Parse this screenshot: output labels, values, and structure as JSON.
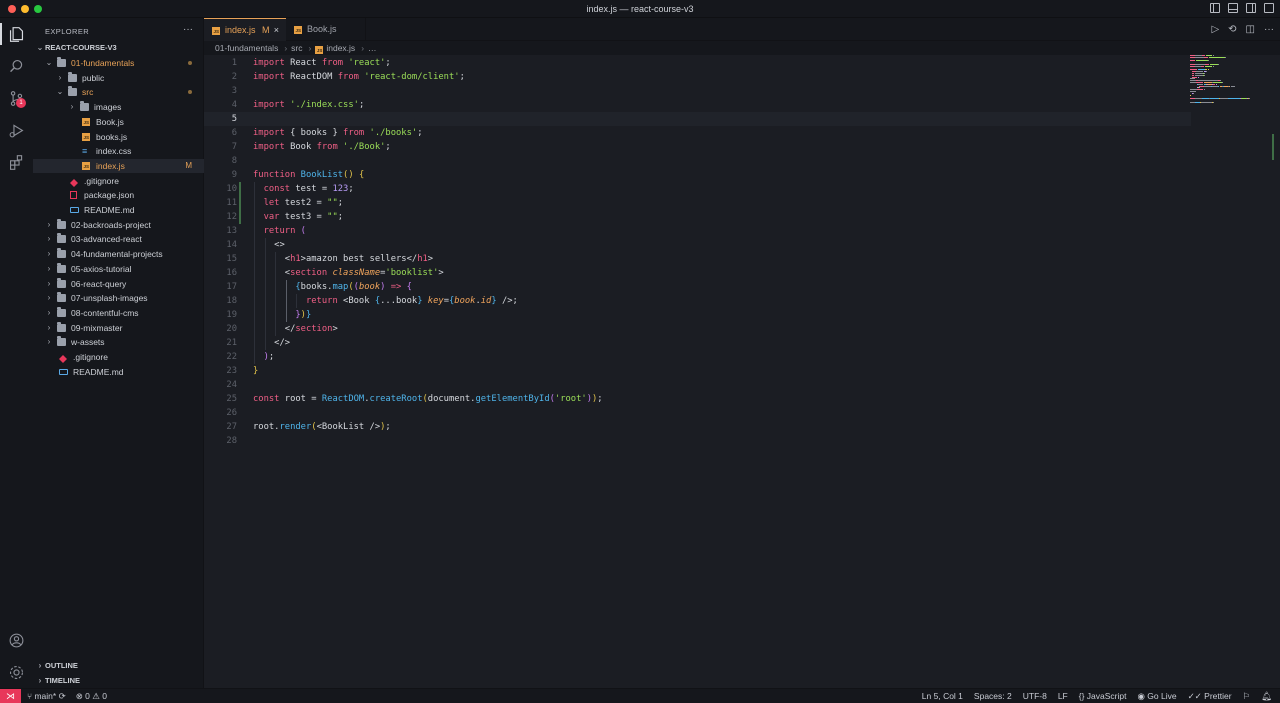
{
  "window": {
    "title": "index.js — react-course-v3"
  },
  "sidebar": {
    "header": "EXPLORER",
    "more": "···",
    "project": "REACT-COURSE-V3",
    "tree": [
      {
        "label": "01-fundamentals",
        "type": "folder",
        "open": true,
        "depth": 1,
        "orange": true,
        "mod": "dot"
      },
      {
        "label": "public",
        "type": "folder",
        "open": false,
        "depth": 2
      },
      {
        "label": "src",
        "type": "folder",
        "open": true,
        "depth": 2,
        "orange": true,
        "mod": "dot"
      },
      {
        "label": "images",
        "type": "folder",
        "open": false,
        "depth": 3
      },
      {
        "label": "Book.js",
        "type": "js",
        "depth": 3
      },
      {
        "label": "books.js",
        "type": "js",
        "depth": 3
      },
      {
        "label": "index.css",
        "type": "css",
        "depth": 3
      },
      {
        "label": "index.js",
        "type": "js",
        "depth": 3,
        "orange": true,
        "selected": true,
        "mod": "M"
      },
      {
        "label": ".gitignore",
        "type": "git",
        "depth": 2
      },
      {
        "label": "package.json",
        "type": "json",
        "depth": 2
      },
      {
        "label": "README.md",
        "type": "md",
        "depth": 2
      },
      {
        "label": "02-backroads-project",
        "type": "folder",
        "open": false,
        "depth": 1
      },
      {
        "label": "03-advanced-react",
        "type": "folder",
        "open": false,
        "depth": 1
      },
      {
        "label": "04-fundamental-projects",
        "type": "folder",
        "open": false,
        "depth": 1
      },
      {
        "label": "05-axios-tutorial",
        "type": "folder",
        "open": false,
        "depth": 1
      },
      {
        "label": "06-react-query",
        "type": "folder",
        "open": false,
        "depth": 1
      },
      {
        "label": "07-unsplash-images",
        "type": "folder",
        "open": false,
        "depth": 1
      },
      {
        "label": "08-contentful-cms",
        "type": "folder",
        "open": false,
        "depth": 1
      },
      {
        "label": "09-mixmaster",
        "type": "folder",
        "open": false,
        "depth": 1
      },
      {
        "label": "w-assets",
        "type": "folder",
        "open": false,
        "depth": 1
      },
      {
        "label": ".gitignore",
        "type": "git",
        "depth": 1
      },
      {
        "label": "README.md",
        "type": "md",
        "depth": 1
      }
    ],
    "outline": "OUTLINE",
    "timeline": "TIMELINE"
  },
  "activity": {
    "scm_badge": "1"
  },
  "tabs": [
    {
      "label": "index.js",
      "flag": "M",
      "active": true
    },
    {
      "label": "Book.js",
      "flag": "",
      "active": false
    }
  ],
  "breadcrumb": {
    "folder": "01-fundamentals",
    "sub": "src",
    "file": "index.js",
    "tail": "…"
  },
  "editor": {
    "current_line": 5,
    "lines": [
      [
        [
          "kw",
          "import"
        ],
        [
          "pn",
          " React "
        ],
        [
          "kw",
          "from"
        ],
        [
          "pn",
          " "
        ],
        [
          "str",
          "'react'"
        ],
        [
          "pn",
          ";"
        ]
      ],
      [
        [
          "kw",
          "import"
        ],
        [
          "pn",
          " ReactDOM "
        ],
        [
          "kw",
          "from"
        ],
        [
          "pn",
          " "
        ],
        [
          "str",
          "'react-dom/client'"
        ],
        [
          "pn",
          ";"
        ]
      ],
      [],
      [
        [
          "kw",
          "import"
        ],
        [
          "pn",
          " "
        ],
        [
          "str",
          "'./index.css'"
        ],
        [
          "pn",
          ";"
        ]
      ],
      [],
      [
        [
          "kw",
          "import"
        ],
        [
          "pn",
          " { books } "
        ],
        [
          "kw",
          "from"
        ],
        [
          "pn",
          " "
        ],
        [
          "str",
          "'./books'"
        ],
        [
          "pn",
          ";"
        ]
      ],
      [
        [
          "kw",
          "import"
        ],
        [
          "pn",
          " Book "
        ],
        [
          "kw",
          "from"
        ],
        [
          "pn",
          " "
        ],
        [
          "str",
          "'./Book'"
        ],
        [
          "pn",
          ";"
        ]
      ],
      [],
      [
        [
          "kw",
          "function"
        ],
        [
          "pn",
          " "
        ],
        [
          "fn",
          "BookList"
        ],
        [
          "br1",
          "()"
        ],
        [
          "pn",
          " "
        ],
        [
          "br1",
          "{"
        ]
      ],
      [
        [
          "pn",
          "  "
        ],
        [
          "kw",
          "const"
        ],
        [
          "pn",
          " test = "
        ],
        [
          "num",
          "123"
        ],
        [
          "pn",
          ";"
        ]
      ],
      [
        [
          "pn",
          "  "
        ],
        [
          "kw",
          "let"
        ],
        [
          "pn",
          " test2 = "
        ],
        [
          "str",
          "\"\""
        ],
        [
          "pn",
          ";"
        ]
      ],
      [
        [
          "pn",
          "  "
        ],
        [
          "kw",
          "var"
        ],
        [
          "pn",
          " test3 = "
        ],
        [
          "str",
          "\"\""
        ],
        [
          "pn",
          ";"
        ]
      ],
      [
        [
          "pn",
          "  "
        ],
        [
          "kw",
          "return"
        ],
        [
          "pn",
          " "
        ],
        [
          "br2",
          "("
        ]
      ],
      [
        [
          "pn",
          "    <>"
        ]
      ],
      [
        [
          "pn",
          "      <"
        ],
        [
          "tag",
          "h1"
        ],
        [
          "pn",
          ">amazon best sellers</"
        ],
        [
          "tag",
          "h1"
        ],
        [
          "pn",
          ">"
        ]
      ],
      [
        [
          "pn",
          "      <"
        ],
        [
          "tag",
          "section"
        ],
        [
          "pn",
          " "
        ],
        [
          "attr",
          "className"
        ],
        [
          "pn",
          "="
        ],
        [
          "str",
          "'booklist'"
        ],
        [
          "pn",
          ">"
        ]
      ],
      [
        [
          "pn",
          "        "
        ],
        [
          "br3",
          "{"
        ],
        [
          "pn",
          "books."
        ],
        [
          "fn",
          "map"
        ],
        [
          "br1",
          "("
        ],
        [
          "br2",
          "("
        ],
        [
          "prm",
          "book"
        ],
        [
          "br2",
          ")"
        ],
        [
          "pn",
          " "
        ],
        [
          "kw",
          "=>"
        ],
        [
          "pn",
          " "
        ],
        [
          "br2",
          "{"
        ]
      ],
      [
        [
          "pn",
          "          "
        ],
        [
          "kw",
          "return"
        ],
        [
          "pn",
          " <Book "
        ],
        [
          "br3",
          "{"
        ],
        [
          "pn",
          "...book"
        ],
        [
          "br3",
          "}"
        ],
        [
          "pn",
          " "
        ],
        [
          "attr",
          "key"
        ],
        [
          "pn",
          "="
        ],
        [
          "br3",
          "{"
        ],
        [
          "prm",
          "book"
        ],
        [
          "pn",
          "."
        ],
        [
          "prm",
          "id"
        ],
        [
          "br3",
          "}"
        ],
        [
          "pn",
          " />;"
        ]
      ],
      [
        [
          "pn",
          "        "
        ],
        [
          "br2",
          "}"
        ],
        [
          "br1",
          ")"
        ],
        [
          "br3",
          "}"
        ]
      ],
      [
        [
          "pn",
          "      </"
        ],
        [
          "tag",
          "section"
        ],
        [
          "pn",
          ">"
        ]
      ],
      [
        [
          "pn",
          "    </>"
        ]
      ],
      [
        [
          "pn",
          "  "
        ],
        [
          "br2",
          ")"
        ],
        [
          "pn",
          ";"
        ]
      ],
      [
        [
          "br1",
          "}"
        ]
      ],
      [],
      [
        [
          "kw",
          "const"
        ],
        [
          "pn",
          " root = "
        ],
        [
          "fn",
          "ReactDOM"
        ],
        [
          "pn",
          "."
        ],
        [
          "fn",
          "createRoot"
        ],
        [
          "br1",
          "("
        ],
        [
          "pn",
          "document."
        ],
        [
          "fn",
          "getElementById"
        ],
        [
          "br2",
          "("
        ],
        [
          "str",
          "'root'"
        ],
        [
          "br2",
          ")"
        ],
        [
          "br1",
          ")"
        ],
        [
          "pn",
          ";"
        ]
      ],
      [],
      [
        [
          "pn",
          "root."
        ],
        [
          "fn",
          "render"
        ],
        [
          "br1",
          "("
        ],
        [
          "pn",
          "<BookList />"
        ],
        [
          "br1",
          ")"
        ],
        [
          "pn",
          ";"
        ]
      ],
      []
    ]
  },
  "statusbar": {
    "branch": "main*",
    "errors": "0",
    "warnings": "0",
    "position": "Ln 5, Col 1",
    "spaces": "Spaces: 2",
    "encoding": "UTF-8",
    "eol": "LF",
    "language": "JavaScript",
    "golive": "Go Live",
    "prettier": "Prettier"
  },
  "colors": {
    "accent": "#e7a258",
    "remote": "#e8375a",
    "keyword": "#f05f86",
    "string": "#9bde58",
    "function": "#4fb4ea"
  }
}
